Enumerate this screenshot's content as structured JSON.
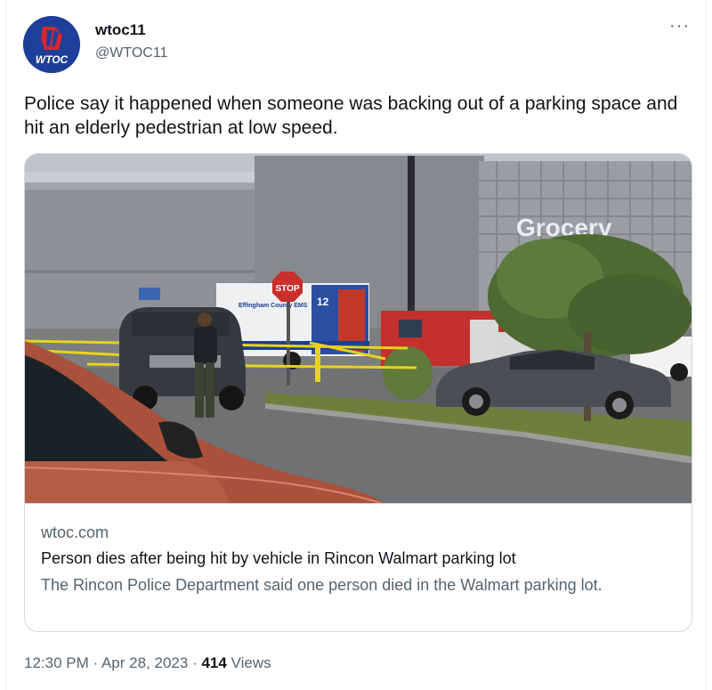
{
  "author": {
    "display_name": "wtoc11",
    "handle": "@WTOC11",
    "avatar_text": "WTOC",
    "avatar_colors": {
      "background": "#1d3f9a",
      "accent": "#d8262d"
    }
  },
  "menu": {
    "more_icon": "more-horizontal-icon",
    "more_label": "···"
  },
  "tweet": {
    "text": "Police say it happened when someone was backing out of a parking space and hit an elderly pedestrian at low speed."
  },
  "card": {
    "image_sign_text": "Grocery",
    "image_stop_sign_text": "STOP",
    "image_ambulance_text": "Effingham County EMS",
    "image_ambulance_number": "12",
    "domain": "wtoc.com",
    "title": "Person dies after being hit by vehicle in Rincon Walmart parking lot",
    "description": "The Rincon Police Department said one person died in the Walmart parking lot."
  },
  "meta": {
    "time": "12:30 PM",
    "separator": "·",
    "date": "Apr 28, 2023",
    "views_count": "414",
    "views_label": "Views"
  },
  "colors": {
    "text_primary": "#0f1419",
    "text_secondary": "#536471",
    "border": "#cfd9de"
  }
}
